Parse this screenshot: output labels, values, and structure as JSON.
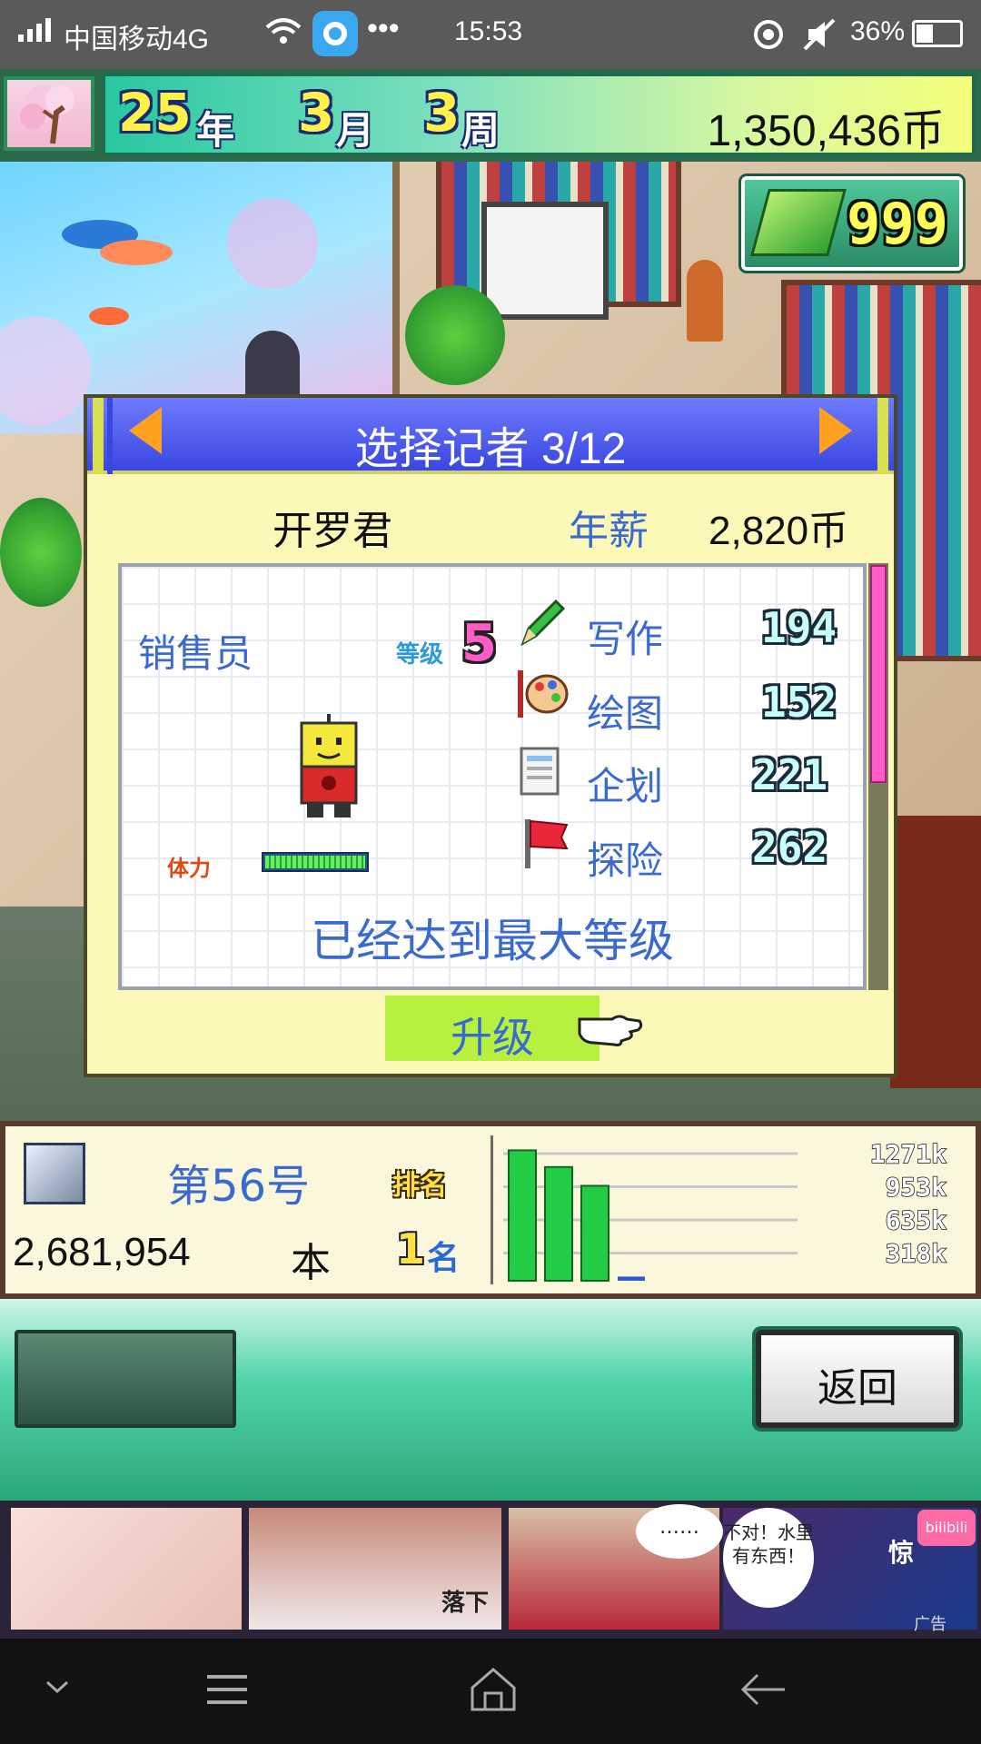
{
  "status_bar": {
    "carrier": "中国移动4G",
    "time": "15:53",
    "battery": "36%",
    "icons": [
      "signal-icon",
      "wifi-icon",
      "app-notification-icon",
      "more-dots-icon",
      "location-icon",
      "mute-icon",
      "battery-icon"
    ]
  },
  "header": {
    "year_num": "25",
    "year_unit": "年",
    "month_num": "3",
    "month_unit": "月",
    "week_num": "3",
    "week_unit": "周",
    "money": "1,350,436币"
  },
  "book_counter": {
    "count": "999"
  },
  "dialog": {
    "title": "选择记者 3/12",
    "reporter_name": "开罗君",
    "salary_label": "年薪",
    "salary_value": "2,820币",
    "job": "销售员",
    "level_label": "等级",
    "level_value": "5",
    "stats": [
      {
        "label": "写作",
        "value": "194",
        "icon": "pencil-icon"
      },
      {
        "label": "绘图",
        "value": "152",
        "icon": "palette-icon"
      },
      {
        "label": "企划",
        "value": "221",
        "icon": "document-icon"
      },
      {
        "label": "探险",
        "value": "262",
        "icon": "flag-icon"
      }
    ],
    "stamina_label": "体力",
    "stamina_level": 1.0,
    "max_level_text": "已经达到最大等级",
    "upgrade_label": "升级"
  },
  "info_panel": {
    "issue_number": "第56号",
    "rank_badge": "排名",
    "sales_count": "2,681,954",
    "unit": "本",
    "rank_value": "1",
    "rank_unit": "名"
  },
  "chart_data": {
    "type": "bar",
    "categories": [
      "",
      "",
      "",
      ""
    ],
    "values": [
      1250,
      1090,
      910,
      40
    ],
    "tick_labels": [
      "1271k",
      "953k",
      "635k",
      "318k"
    ],
    "ylim": [
      0,
      1271
    ],
    "grid": true,
    "bar_color": "#22cc44",
    "title": "",
    "xlabel": "",
    "ylabel": ""
  },
  "bottom": {
    "back_label": "返回"
  },
  "ad": {
    "bubble1": "……",
    "bubble2": "不对！水里有东西！",
    "text_fall": "落下",
    "text_shock": "惊",
    "logo": "bilibili",
    "ad_label": "广告"
  },
  "colors": {
    "accent_blue": "#3a6ad0",
    "dialog_bg": "#fbf8b8",
    "title_bar": "#3a46e0",
    "teal": "#2aa878"
  }
}
